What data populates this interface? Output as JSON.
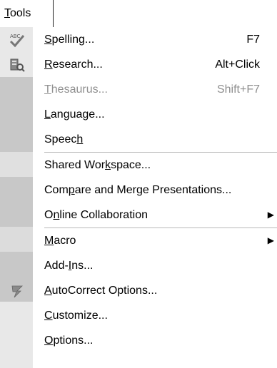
{
  "menubar": {
    "tab_label": "Tools"
  },
  "menu": {
    "items": [
      {
        "label": "Spelling...",
        "shortcut": "F7",
        "icon": "spelling-abc-check-icon"
      },
      {
        "label": "Research...",
        "shortcut": "Alt+Click",
        "icon": "research-book-icon"
      },
      {
        "label": "Thesaurus...",
        "shortcut": "Shift+F7",
        "disabled": true
      },
      {
        "label": "Language..."
      },
      {
        "label": "Speech"
      },
      {
        "label": "Shared Workspace..."
      },
      {
        "label": "Compare and Merge Presentations..."
      },
      {
        "label": "Online Collaboration",
        "submenu": true
      },
      {
        "label": "Macro",
        "submenu": true
      },
      {
        "label": "Add-Ins..."
      },
      {
        "label": "AutoCorrect Options...",
        "icon": "autocorrect-lightning-icon"
      },
      {
        "label": "Customize..."
      },
      {
        "label": "Options..."
      }
    ]
  },
  "colors": {
    "gutter": "#e8e8e8",
    "gutter_dark": "#c8c8c8",
    "disabled_text": "#8f8f8f",
    "separator": "#b8b8b8"
  }
}
